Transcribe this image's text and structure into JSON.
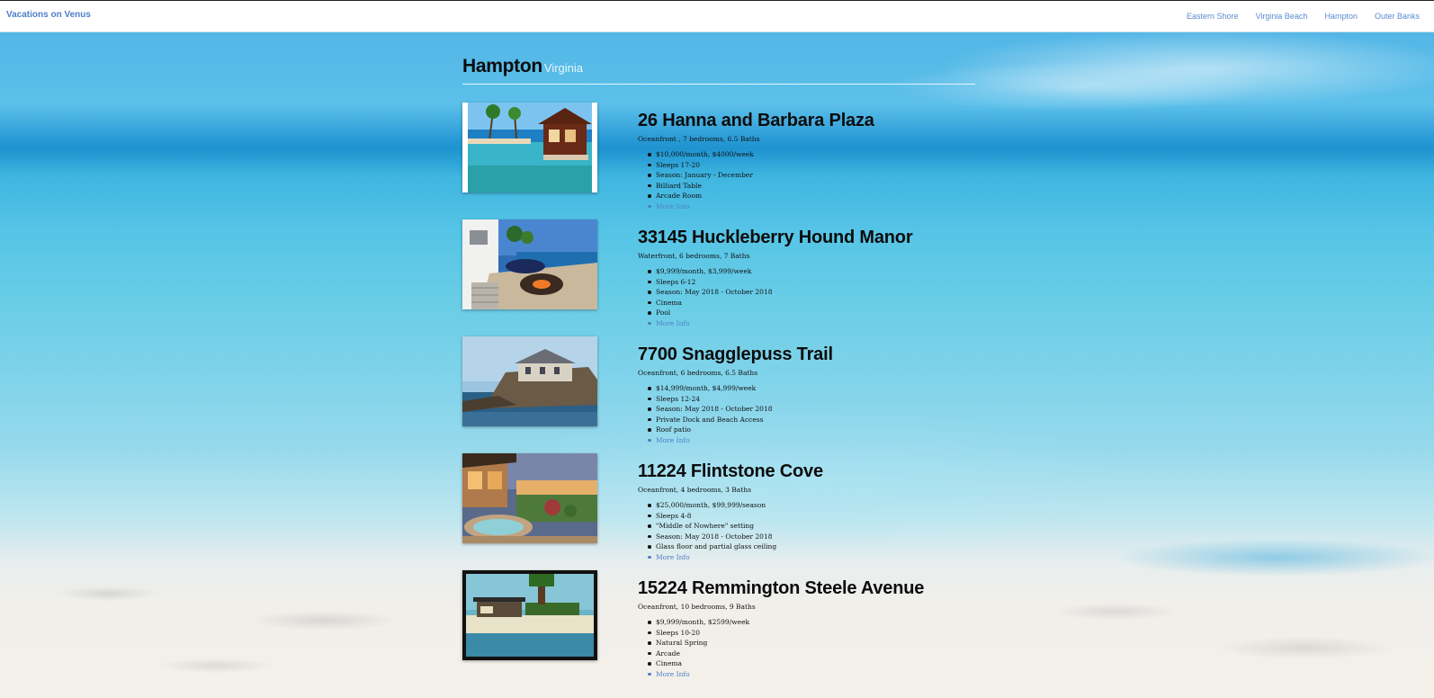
{
  "navbar": {
    "brand": "Vacations on Venus",
    "links": [
      {
        "label": "Eastern Shore"
      },
      {
        "label": "Virginia Beach"
      },
      {
        "label": "Hampton"
      },
      {
        "label": "Outer Banks"
      }
    ]
  },
  "header": {
    "city": "Hampton",
    "state": "Virginia"
  },
  "listings": [
    {
      "title": "26 Hanna and Barbara Plaza",
      "summary": "Oceanfront , 7 bedrooms, 6.5 Baths",
      "features": [
        "$10,000/month, $4000/week",
        "Sleeps 17-20",
        "Season: January - December",
        "Billiard Table",
        "Arcade Room"
      ],
      "more": "More Info",
      "image": "infinity-pool-villa-photo"
    },
    {
      "title": "33145 Huckleberry Hound Manor",
      "summary": "Waterfront, 6 bedrooms, 7 Baths",
      "features": [
        "$9,999/month, $3,999/week",
        "Sleeps 6-12",
        "Season: May 2018 - October 2018",
        "Cinema",
        "Pool"
      ],
      "more": "More Info",
      "image": "terrace-fire-pit-photo"
    },
    {
      "title": "7700 Snagglepuss Trail",
      "summary": "Oceanfront, 6 bedrooms, 6.5 Baths",
      "features": [
        "$14,999/month, $4,999/week",
        "Sleeps 12-24",
        "Season: May 2018 - October 2018",
        "Private Dock and Beach Access",
        "Roof patio"
      ],
      "more": "More Info",
      "image": "cliff-mansion-photo"
    },
    {
      "title": "11224 Flintstone Cove",
      "summary": "Oceanfront, 4 bedrooms, 3 Baths",
      "features": [
        "$25,000/month, $99,999/season",
        "Sleeps 4-8",
        "\"Middle of Nowhere\" setting",
        "Season: May 2018 - October 2018",
        "Glass floor and partial glass ceiling"
      ],
      "more": "More Info",
      "image": "hot-tub-patio-photo"
    },
    {
      "title": "15224 Remmington Steele Avenue",
      "summary": "Oceanfront, 10 bedrooms, 9 Baths",
      "features": [
        "$9,999/month, $2599/week",
        "Sleeps 10-20",
        "Natural Spring",
        "Arcade",
        "Cinema"
      ],
      "more": "More Info",
      "image": "blocky-beach-house-photo"
    }
  ]
}
